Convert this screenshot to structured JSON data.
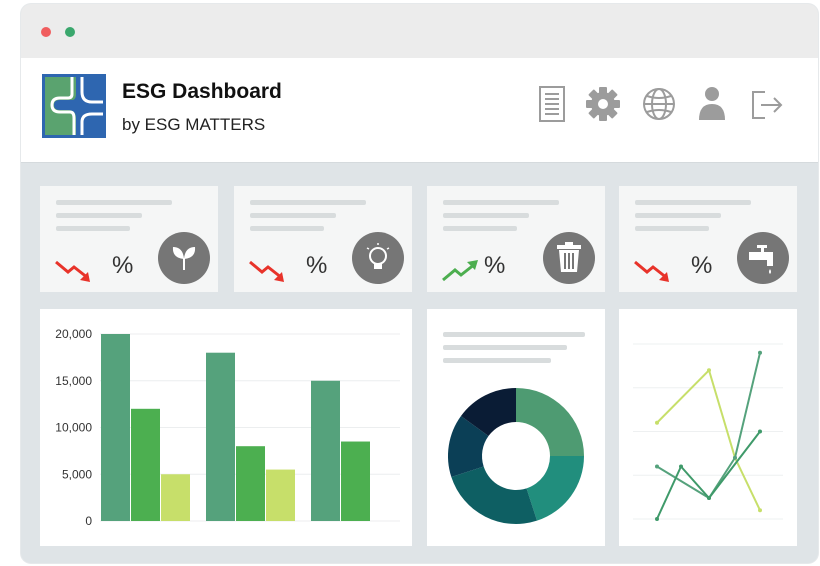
{
  "app": {
    "title": "ESG Dashboard",
    "subtitle": "by ESG MATTERS"
  },
  "toolbar_icons": [
    "document-icon",
    "gear-icon",
    "globe-icon",
    "user-icon",
    "logout-icon"
  ],
  "kpi_cards": [
    {
      "trend": "down",
      "trend_color": "#e8332a",
      "percent_label": "%",
      "icon": "leaf-icon"
    },
    {
      "trend": "down",
      "trend_color": "#e8332a",
      "percent_label": "%",
      "icon": "lightbulb-icon"
    },
    {
      "trend": "up",
      "trend_color": "#4cae4f",
      "percent_label": "%",
      "icon": "trash-icon"
    },
    {
      "trend": "down",
      "trend_color": "#e8332a",
      "percent_label": "%",
      "icon": "faucet-icon"
    }
  ],
  "colors": {
    "series_dark": "#55a27c",
    "series_mid": "#4caf50",
    "series_light": "#c7df6a",
    "window_bg": "#dfe4e7"
  },
  "chart_data": [
    {
      "type": "bar",
      "categories": [
        "",
        "",
        ""
      ],
      "series": [
        {
          "values": [
            20000,
            18000,
            15000
          ],
          "color": "#55a27c"
        },
        {
          "values": [
            12000,
            8000,
            8500
          ],
          "color": "#4caf50"
        },
        {
          "values": [
            5000,
            5500,
            null
          ],
          "color": "#c7df6a"
        }
      ],
      "yticks": [
        "0",
        "5,000",
        "10,000",
        "15,000",
        "20,000"
      ],
      "ylim": [
        0,
        20000
      ],
      "grid": true
    },
    {
      "type": "pie",
      "donut": true,
      "values": [
        25,
        20,
        25,
        15,
        15
      ],
      "colors": [
        "#4e9b72",
        "#218e7d",
        "#0e5f63",
        "#0b3f56",
        "#0a1c35"
      ]
    },
    {
      "type": "line",
      "x": [
        0,
        1,
        2,
        3
      ],
      "series": [
        {
          "values": [
            0.55,
            0.85,
            0.35,
            0.05
          ],
          "color": "#c7df6a"
        },
        {
          "values": [
            0.3,
            0.12,
            0.35,
            0.95
          ],
          "color": "#55a27c"
        },
        {
          "values": [
            0.0,
            0.3,
            0.12,
            0.5
          ],
          "color": "#3f9a6a"
        }
      ],
      "grid": true
    }
  ]
}
